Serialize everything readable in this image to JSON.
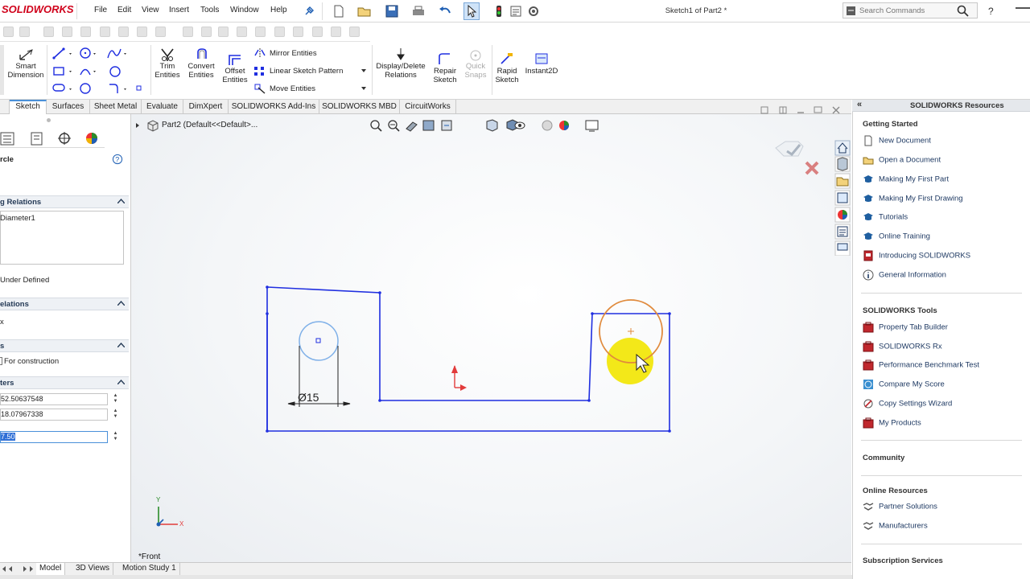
{
  "app": {
    "logo": "SOLIDWORKS",
    "menu": [
      "File",
      "Edit",
      "View",
      "Insert",
      "Tools",
      "Window",
      "Help"
    ],
    "doc_title": "Sketch1 of Part2 *",
    "search_placeholder": "Search Commands"
  },
  "ribbon": {
    "smart_dimension": "Smart Dimension",
    "trim": "Trim Entities",
    "convert": "Convert Entities",
    "offset": "Offset Entities",
    "mirror": "Mirror Entities",
    "linear_pattern": "Linear Sketch Pattern",
    "move": "Move Entities",
    "display_delete": "Display/Delete Relations",
    "repair": "Repair Sketch",
    "quick_snaps": "Quick Snaps",
    "rapid": "Rapid Sketch",
    "instant2d": "Instant2D"
  },
  "tabs": [
    "Sketch",
    "Surfaces",
    "Sheet Metal",
    "Evaluate",
    "DimXpert",
    "SOLIDWORKS Add-Ins",
    "SOLIDWORKS MBD",
    "CircuitWorks"
  ],
  "left_panel": {
    "title": "rcle",
    "sec_relations": "g Relations",
    "relation_item": "Diameter1",
    "under_defined": "Under Defined",
    "sec_add_relations": "elations",
    "add_relation_item": "x",
    "sec_options": "s",
    "for_construction": "For construction",
    "sec_parameters": "ters",
    "param_x": "52.50637548",
    "param_y": "18.07967338",
    "param_r": "7.50"
  },
  "graphics": {
    "breadcrumb": "Part2  (Default<<Default>...",
    "dimension": "Ø15",
    "view_label": "*Front",
    "axis_x": "X",
    "axis_y": "Y"
  },
  "bottom_tabs": [
    "Model",
    "3D Views",
    "Motion Study 1"
  ],
  "task_pane": {
    "title": "SOLIDWORKS Resources",
    "getting_started": "Getting Started",
    "gs_items": [
      "New Document",
      "Open a Document",
      "Making My First Part",
      "Making My First Drawing",
      "Tutorials",
      "Online Training",
      "Introducing SOLIDWORKS",
      "General Information"
    ],
    "tools": "SOLIDWORKS Tools",
    "tools_items": [
      "Property Tab Builder",
      "SOLIDWORKS Rx",
      "Performance Benchmark Test",
      "Compare My Score",
      "Copy Settings Wizard",
      "My Products"
    ],
    "community": "Community",
    "online_resources": "Online Resources",
    "online_items": [
      "Partner Solutions",
      "Manufacturers"
    ],
    "subscription": "Subscription Services"
  },
  "colors": {
    "sketch_blue": "#1f2ee0",
    "selected_circle": "#e08a3c",
    "construction_blue": "#7fb0e8",
    "cursor_highlight": "#f2e600",
    "brand_red": "#d0021b"
  }
}
